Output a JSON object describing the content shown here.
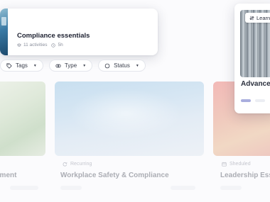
{
  "course": {
    "title": "Compliance essentials",
    "activities": "11 activities",
    "duration": "5h"
  },
  "filters": [
    {
      "label": "Tags",
      "icon": "tag-icon"
    },
    {
      "label": "Type",
      "icon": "type-icon"
    },
    {
      "label": "Status",
      "icon": "status-circle-icon"
    }
  ],
  "gallery": [
    {
      "title": "ement",
      "meta": ""
    },
    {
      "title": "Workplace Safety & Compliance",
      "meta": "Recurring"
    },
    {
      "title": "Leadership Esse",
      "meta": "Sheduled"
    }
  ],
  "popover": {
    "badge": "Learn",
    "title": "Advance",
    "progress": 0.5
  },
  "colors": {
    "accent": "#a9aede",
    "text": "#1c2030",
    "muted": "#8a8f9c"
  }
}
